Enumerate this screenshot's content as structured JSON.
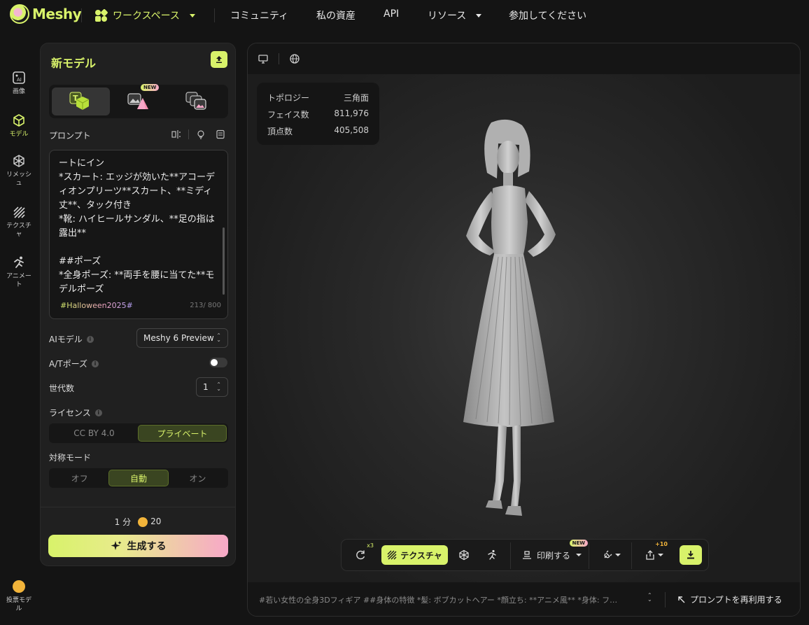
{
  "brand": {
    "name": "Meshy",
    "accent": "#d8f26a"
  },
  "nav": {
    "workspace": "ワークスペース",
    "items": [
      "コミュニティ",
      "私の資産",
      "API",
      "リソース",
      "参加してください"
    ]
  },
  "rail": {
    "items": [
      {
        "label": "画像",
        "icon": "image-ai-icon"
      },
      {
        "label": "モデル",
        "icon": "cube-icon",
        "active": true
      },
      {
        "label": "リメッシュ",
        "icon": "remesh-icon"
      },
      {
        "label": "テクスチャ",
        "icon": "texture-icon"
      },
      {
        "label": "アニメート",
        "icon": "running-icon"
      }
    ],
    "vote_label": "投票モデル"
  },
  "panel": {
    "title": "新モデル",
    "mode_tabs": [
      {
        "name": "text-to-3d",
        "active": true
      },
      {
        "name": "image-to-3d",
        "badge": "NEW"
      },
      {
        "name": "multi-image-to-3d"
      }
    ],
    "prompt_label": "プロンプト",
    "prompt_text": "ートにイン\n*スカート: エッジが効いた**アコーディオンプリーツ**スカート、**ミディ丈**、タック付き\n*靴: ハイヒールサンダル、**足の指は露出**\n\n##ポーズ\n*全身ポーズ: **両手を腰に当てた**モデルポーズ",
    "hashtag": "#Halloween2025#",
    "char_count": "213/ 800",
    "ai_model_label": "AIモデル",
    "ai_model_value": "Meshy 6 Preview",
    "atpose_label": "A/Tポーズ",
    "atpose_on": false,
    "generations_label": "世代数",
    "generations_value": "1",
    "license_label": "ライセンス",
    "license_options": [
      "CC BY 4.0",
      "プライベート"
    ],
    "license_selected": "プライベート",
    "symmetry_label": "対称モード",
    "symmetry_options": [
      "オフ",
      "自動",
      "オン"
    ],
    "symmetry_selected": "自動",
    "time": "1 分",
    "credits": "20",
    "generate_label": "生成する"
  },
  "viewer": {
    "stats": [
      {
        "label": "トポロジー",
        "value": "三角面"
      },
      {
        "label": "フェイス数",
        "value": "811,976"
      },
      {
        "label": "頂点数",
        "value": "405,508"
      }
    ],
    "toolbar": {
      "retry_badge": "x3",
      "texture_label": "テクスチャ",
      "print_label": "印刷する",
      "print_badge": "NEW",
      "share_badge": "+10"
    },
    "bottom_prompt": "#若い女性の全身3Dフィギア ##身体の特徴 *髪: ボブカットヘアー *顔立ち: **アニメ風** *身体: フ…",
    "reuse_label": "プロンプトを再利用する"
  }
}
